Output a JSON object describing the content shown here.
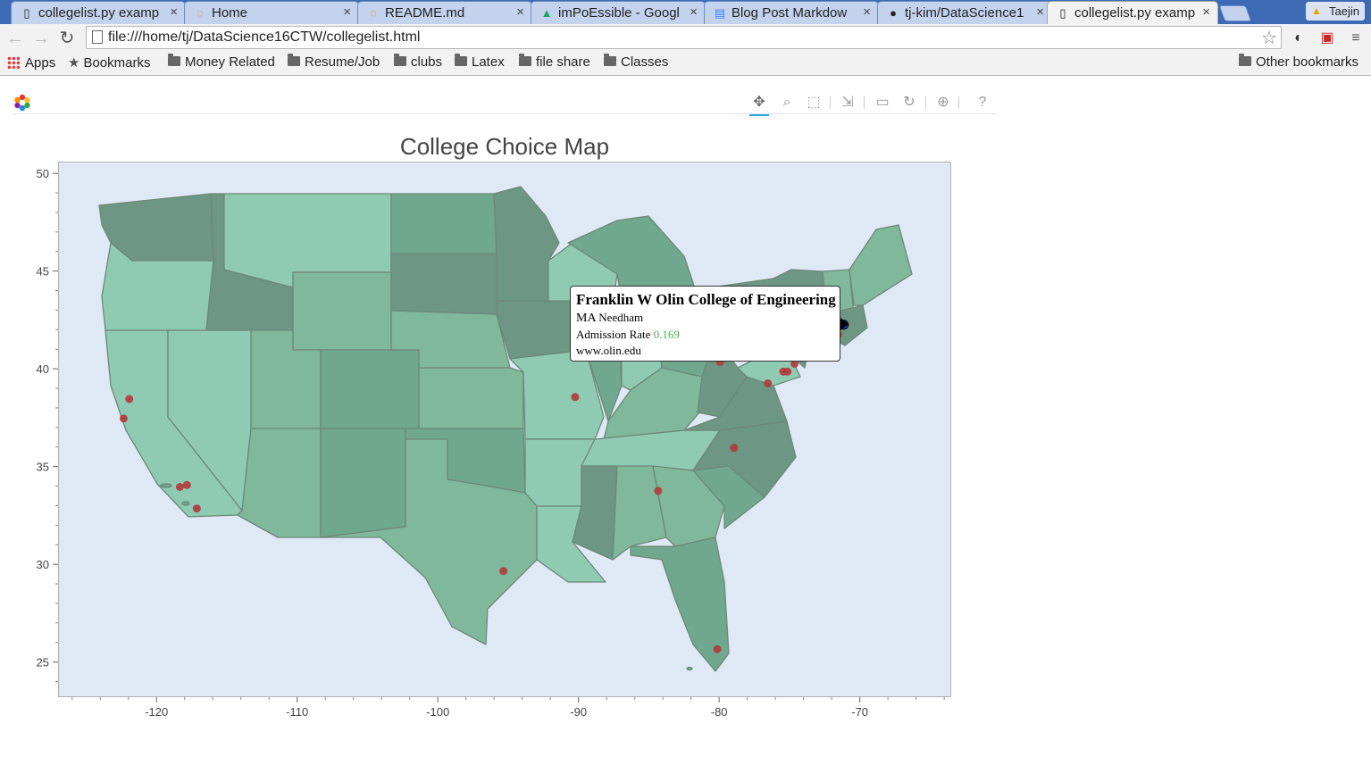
{
  "browser": {
    "tabs": [
      {
        "title": "collegelist.py examp",
        "icon": "page-icon",
        "active": false
      },
      {
        "title": "Home",
        "icon": "jupyter-icon",
        "active": false
      },
      {
        "title": "README.md",
        "icon": "jupyter-icon",
        "active": false
      },
      {
        "title": "imPoEssible - Googl",
        "icon": "google-drive-icon",
        "active": false
      },
      {
        "title": "Blog Post Markdow",
        "icon": "google-docs-icon",
        "active": false
      },
      {
        "title": "tj-kim/DataScience1",
        "icon": "github-icon",
        "active": false
      },
      {
        "title": "collegelist.py examp",
        "icon": "page-icon",
        "active": true
      }
    ],
    "profile_name": "Taejin",
    "url": "file:///home/tj/DataScience16CTW/collegelist.html",
    "bookmarks": [
      {
        "label": "Apps",
        "icon": "apps-grid-icon"
      },
      {
        "label": "Bookmarks",
        "icon": "star-icon"
      },
      {
        "label": "Money Related",
        "icon": "folder-icon"
      },
      {
        "label": "Resume/Job",
        "icon": "folder-icon"
      },
      {
        "label": "clubs",
        "icon": "folder-icon"
      },
      {
        "label": "Latex",
        "icon": "folder-icon"
      },
      {
        "label": "file share",
        "icon": "folder-icon"
      },
      {
        "label": "Classes",
        "icon": "folder-icon"
      }
    ],
    "other_bookmarks": "Other bookmarks"
  },
  "bokeh_tools": [
    {
      "name": "pan-tool",
      "icon": "pan-icon",
      "active": true
    },
    {
      "name": "wheel-zoom-tool",
      "icon": "wheel-zoom-icon",
      "active": false
    },
    {
      "name": "box-zoom-tool",
      "icon": "box-zoom-icon",
      "active": false
    },
    {
      "name": "resize-tool",
      "icon": "resize-icon",
      "active": false
    },
    {
      "name": "save-tool",
      "icon": "save-icon",
      "active": false
    },
    {
      "name": "reset-tool",
      "icon": "reset-icon",
      "active": false
    },
    {
      "name": "hover-tool",
      "icon": "hover-icon",
      "active": false
    },
    {
      "name": "help-tool",
      "icon": "help-icon",
      "active": false
    }
  ],
  "chart_data": {
    "type": "scatter",
    "title": "College Choice Map",
    "xlabel": "",
    "ylabel": "",
    "xlim": [
      -127,
      -63.5
    ],
    "ylim": [
      23.2,
      50.6
    ],
    "xticks": [
      -120,
      -110,
      -100,
      -90,
      -80,
      -70
    ],
    "yticks": [
      25,
      30,
      35,
      40,
      45,
      50
    ],
    "colors": {
      "background": "#dfe9f6",
      "state_light": "#8fcab3",
      "state_mid": "#7fb89a",
      "state_dark": "#6d9684",
      "point": "#b03a3a",
      "selected_point": "#1f3fcf"
    },
    "points": [
      {
        "x": -122.0,
        "y": 38.5
      },
      {
        "x": -122.4,
        "y": 37.5
      },
      {
        "x": -118.4,
        "y": 34.0
      },
      {
        "x": -117.9,
        "y": 34.1
      },
      {
        "x": -117.2,
        "y": 32.9
      },
      {
        "x": -95.4,
        "y": 29.7
      },
      {
        "x": -90.3,
        "y": 38.6
      },
      {
        "x": -84.4,
        "y": 33.8
      },
      {
        "x": -80.2,
        "y": 25.7
      },
      {
        "x": -79.0,
        "y": 36.0
      },
      {
        "x": -80.0,
        "y": 40.4
      },
      {
        "x": -76.6,
        "y": 39.3
      },
      {
        "x": -75.2,
        "y": 39.9
      },
      {
        "x": -75.5,
        "y": 39.9
      },
      {
        "x": -74.7,
        "y": 40.3
      },
      {
        "x": -71.6,
        "y": 41.8
      },
      {
        "x": -71.2,
        "y": 42.3
      }
    ],
    "hovered": {
      "name": "Franklin W Olin College of Engineering",
      "state": "MA",
      "city": "Needham",
      "rate_label": "Admission Rate",
      "admission_rate": "0.169",
      "url": "www.olin.edu",
      "x": -71.2,
      "y": 42.3
    }
  }
}
